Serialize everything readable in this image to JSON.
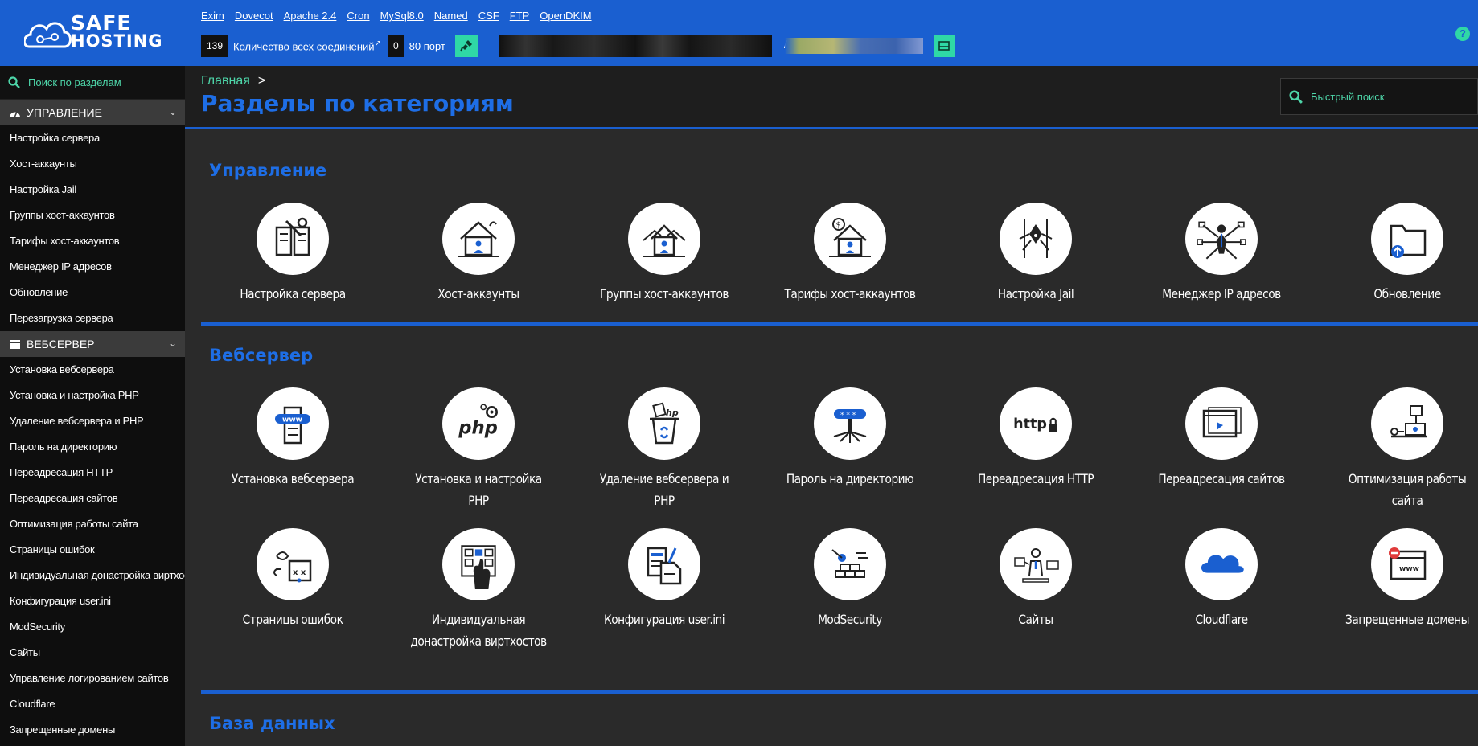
{
  "header": {
    "logo_line1": "SAFE",
    "logo_line2": "HOSTING",
    "services": [
      "Exim",
      "Dovecot",
      "Apache 2.4",
      "Cron",
      "MySql8.0",
      "Named",
      "CSF",
      "FTP",
      "OpenDKIM"
    ],
    "connections_count": "139",
    "connections_label": "Количество всех соединений",
    "ports_count": "0",
    "ports_label": "80 порт",
    "blurred_prefix": "/",
    "help_label": "?"
  },
  "sidebar": {
    "search_placeholder": "Поиск по разделам",
    "categories": [
      {
        "label": "УПРАВЛЕНИЕ",
        "items": [
          "Настройка сервера",
          "Хост-аккаунты",
          "Настройка Jail",
          "Группы хост-аккаунтов",
          "Тарифы хост-аккаунтов",
          "Менеджер IP адресов",
          "Обновление",
          "Перезагрузка сервера"
        ]
      },
      {
        "label": "ВЕБСЕРВЕР",
        "items": [
          "Установка вебсервера",
          "Установка и настройка PHP",
          "Удаление вебсервера и PHP",
          "Пароль на директорию",
          "Переадресация HTTP",
          "Переадресация сайтов",
          "Оптимизация работы сайта",
          "Страницы ошибок",
          "Индивидуальная донастройка виртхостов",
          "Конфигурация user.ini",
          "ModSecurity",
          "Сайты",
          "Управление логированием сайтов",
          "Cloudflare",
          "Запрещенные домены"
        ]
      }
    ]
  },
  "main": {
    "breadcrumb": "Главная",
    "breadcrumb_sep": ">",
    "title": "Разделы по категориям",
    "quick_search_placeholder": "Быстрый поиск",
    "sections": [
      {
        "title": "Управление",
        "tiles": [
          {
            "label": "Настройка сервера",
            "icon": "server-settings-icon"
          },
          {
            "label": "Хост-аккаунты",
            "icon": "house-user-icon"
          },
          {
            "label": "Группы хост-аккаунтов",
            "icon": "house-group-icon"
          },
          {
            "label": "Тарифы хост-аккаунтов",
            "icon": "house-tariff-icon"
          },
          {
            "label": "Настройка Jail",
            "icon": "jail-spider-icon"
          },
          {
            "label": "Менеджер IP адресов",
            "icon": "network-manager-icon"
          },
          {
            "label": "Обновление",
            "icon": "folder-update-icon"
          }
        ]
      },
      {
        "title": "Вебсервер",
        "tiles": [
          {
            "label": "Установка вебсервера",
            "icon": "webserver-install-icon"
          },
          {
            "label": "Установка и настройка PHP",
            "icon": "php-icon"
          },
          {
            "label": "Удаление вебсервера и PHP",
            "icon": "php-delete-icon"
          },
          {
            "label": "Пароль на директорию",
            "icon": "directory-password-icon"
          },
          {
            "label": "Переадресация HTTP",
            "icon": "http-redirect-icon"
          },
          {
            "label": "Переадресация сайтов",
            "icon": "site-redirect-icon"
          },
          {
            "label": "Оптимизация работы сайта",
            "icon": "site-optimization-icon"
          },
          {
            "label": "Страницы ошибок",
            "icon": "error-pages-icon"
          },
          {
            "label": "Индивидуальная донастройка виртхостов",
            "icon": "vhost-custom-icon"
          },
          {
            "label": "Конфигурация user.ini",
            "icon": "user-ini-icon"
          },
          {
            "label": "ModSecurity",
            "icon": "modsecurity-icon"
          },
          {
            "label": "Сайты",
            "icon": "sites-icon"
          },
          {
            "label": "Cloudflare",
            "icon": "cloudflare-icon"
          },
          {
            "label": "Запрещенные домены",
            "icon": "forbidden-domains-icon"
          }
        ]
      },
      {
        "title": "База данных",
        "tiles": []
      }
    ]
  },
  "colors": {
    "header_bg": "#1a5fd0",
    "accent_green": "#2fd8a6",
    "title_blue": "#1e6ee6",
    "sidebar_bg": "#0e0e0e",
    "main_bg": "#2a2a2a"
  }
}
